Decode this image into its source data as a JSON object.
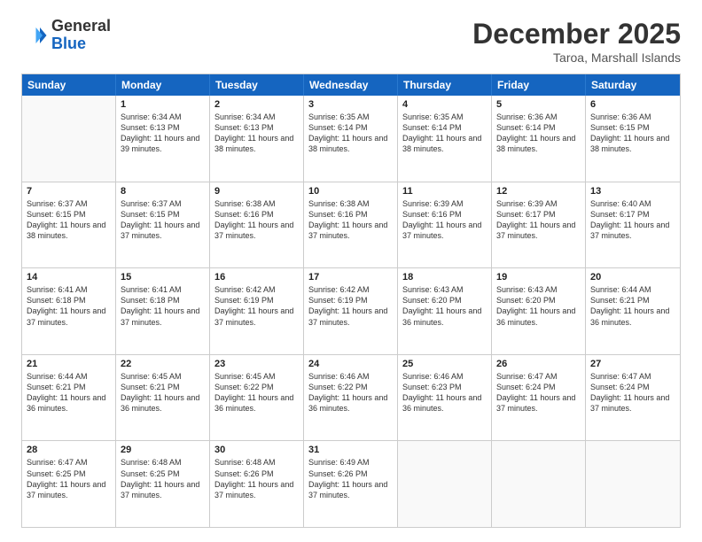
{
  "header": {
    "logo_general": "General",
    "logo_blue": "Blue",
    "month_title": "December 2025",
    "location": "Taroa, Marshall Islands"
  },
  "days_of_week": [
    "Sunday",
    "Monday",
    "Tuesday",
    "Wednesday",
    "Thursday",
    "Friday",
    "Saturday"
  ],
  "weeks": [
    [
      {
        "day": "",
        "empty": true
      },
      {
        "day": "1",
        "sunrise": "6:34 AM",
        "sunset": "6:13 PM",
        "daylight": "11 hours and 39 minutes."
      },
      {
        "day": "2",
        "sunrise": "6:34 AM",
        "sunset": "6:13 PM",
        "daylight": "11 hours and 38 minutes."
      },
      {
        "day": "3",
        "sunrise": "6:35 AM",
        "sunset": "6:14 PM",
        "daylight": "11 hours and 38 minutes."
      },
      {
        "day": "4",
        "sunrise": "6:35 AM",
        "sunset": "6:14 PM",
        "daylight": "11 hours and 38 minutes."
      },
      {
        "day": "5",
        "sunrise": "6:36 AM",
        "sunset": "6:14 PM",
        "daylight": "11 hours and 38 minutes."
      },
      {
        "day": "6",
        "sunrise": "6:36 AM",
        "sunset": "6:15 PM",
        "daylight": "11 hours and 38 minutes."
      }
    ],
    [
      {
        "day": "7",
        "sunrise": "6:37 AM",
        "sunset": "6:15 PM",
        "daylight": "11 hours and 38 minutes."
      },
      {
        "day": "8",
        "sunrise": "6:37 AM",
        "sunset": "6:15 PM",
        "daylight": "11 hours and 37 minutes."
      },
      {
        "day": "9",
        "sunrise": "6:38 AM",
        "sunset": "6:16 PM",
        "daylight": "11 hours and 37 minutes."
      },
      {
        "day": "10",
        "sunrise": "6:38 AM",
        "sunset": "6:16 PM",
        "daylight": "11 hours and 37 minutes."
      },
      {
        "day": "11",
        "sunrise": "6:39 AM",
        "sunset": "6:16 PM",
        "daylight": "11 hours and 37 minutes."
      },
      {
        "day": "12",
        "sunrise": "6:39 AM",
        "sunset": "6:17 PM",
        "daylight": "11 hours and 37 minutes."
      },
      {
        "day": "13",
        "sunrise": "6:40 AM",
        "sunset": "6:17 PM",
        "daylight": "11 hours and 37 minutes."
      }
    ],
    [
      {
        "day": "14",
        "sunrise": "6:41 AM",
        "sunset": "6:18 PM",
        "daylight": "11 hours and 37 minutes."
      },
      {
        "day": "15",
        "sunrise": "6:41 AM",
        "sunset": "6:18 PM",
        "daylight": "11 hours and 37 minutes."
      },
      {
        "day": "16",
        "sunrise": "6:42 AM",
        "sunset": "6:19 PM",
        "daylight": "11 hours and 37 minutes."
      },
      {
        "day": "17",
        "sunrise": "6:42 AM",
        "sunset": "6:19 PM",
        "daylight": "11 hours and 37 minutes."
      },
      {
        "day": "18",
        "sunrise": "6:43 AM",
        "sunset": "6:20 PM",
        "daylight": "11 hours and 36 minutes."
      },
      {
        "day": "19",
        "sunrise": "6:43 AM",
        "sunset": "6:20 PM",
        "daylight": "11 hours and 36 minutes."
      },
      {
        "day": "20",
        "sunrise": "6:44 AM",
        "sunset": "6:21 PM",
        "daylight": "11 hours and 36 minutes."
      }
    ],
    [
      {
        "day": "21",
        "sunrise": "6:44 AM",
        "sunset": "6:21 PM",
        "daylight": "11 hours and 36 minutes."
      },
      {
        "day": "22",
        "sunrise": "6:45 AM",
        "sunset": "6:21 PM",
        "daylight": "11 hours and 36 minutes."
      },
      {
        "day": "23",
        "sunrise": "6:45 AM",
        "sunset": "6:22 PM",
        "daylight": "11 hours and 36 minutes."
      },
      {
        "day": "24",
        "sunrise": "6:46 AM",
        "sunset": "6:22 PM",
        "daylight": "11 hours and 36 minutes."
      },
      {
        "day": "25",
        "sunrise": "6:46 AM",
        "sunset": "6:23 PM",
        "daylight": "11 hours and 36 minutes."
      },
      {
        "day": "26",
        "sunrise": "6:47 AM",
        "sunset": "6:24 PM",
        "daylight": "11 hours and 37 minutes."
      },
      {
        "day": "27",
        "sunrise": "6:47 AM",
        "sunset": "6:24 PM",
        "daylight": "11 hours and 37 minutes."
      }
    ],
    [
      {
        "day": "28",
        "sunrise": "6:47 AM",
        "sunset": "6:25 PM",
        "daylight": "11 hours and 37 minutes."
      },
      {
        "day": "29",
        "sunrise": "6:48 AM",
        "sunset": "6:25 PM",
        "daylight": "11 hours and 37 minutes."
      },
      {
        "day": "30",
        "sunrise": "6:48 AM",
        "sunset": "6:26 PM",
        "daylight": "11 hours and 37 minutes."
      },
      {
        "day": "31",
        "sunrise": "6:49 AM",
        "sunset": "6:26 PM",
        "daylight": "11 hours and 37 minutes."
      },
      {
        "day": "",
        "empty": true
      },
      {
        "day": "",
        "empty": true
      },
      {
        "day": "",
        "empty": true
      }
    ]
  ]
}
